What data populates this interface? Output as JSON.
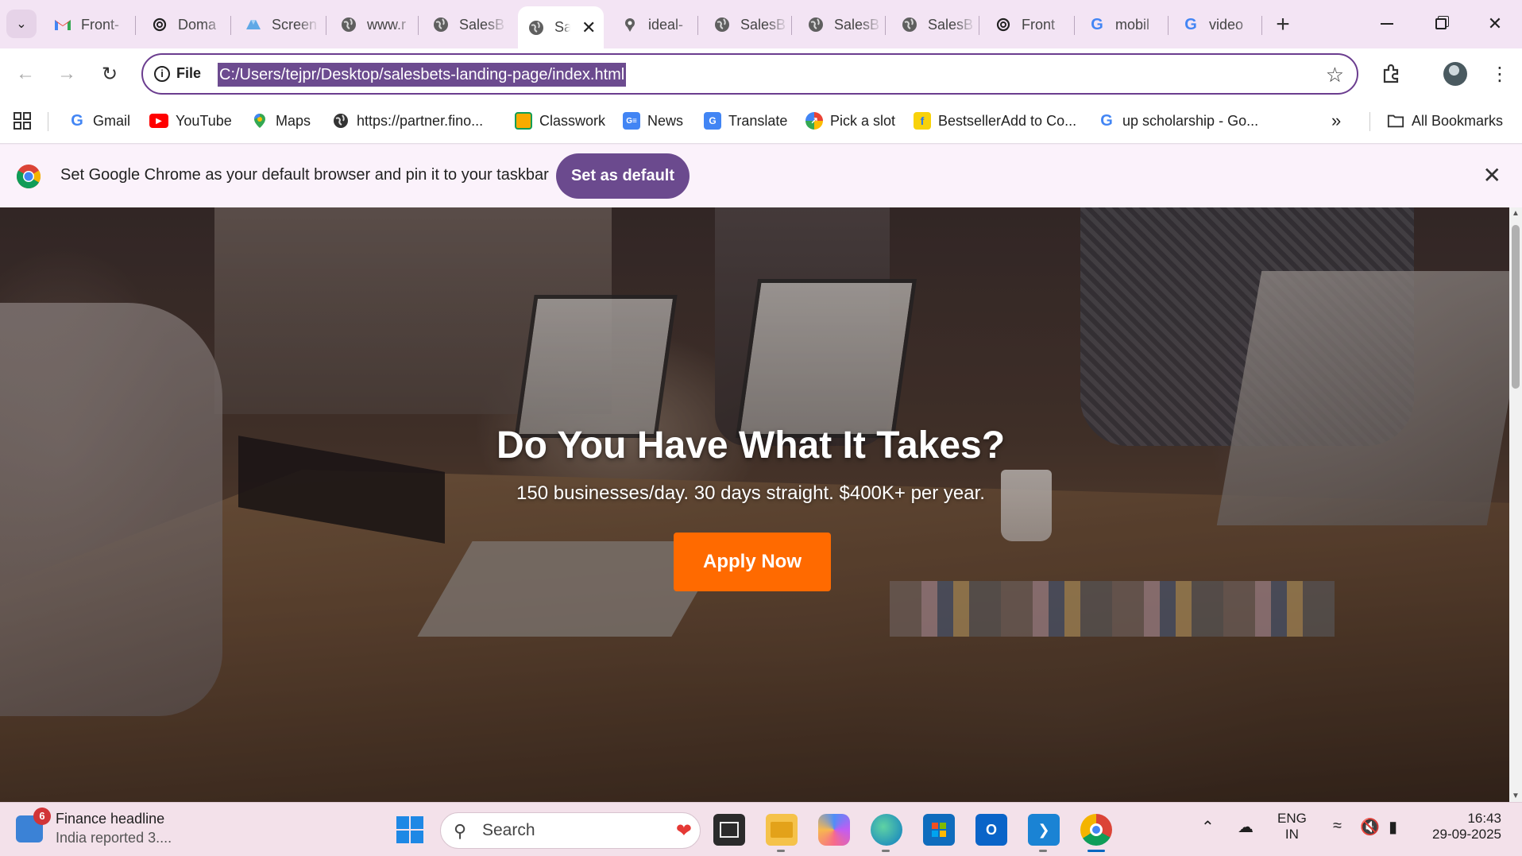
{
  "browser": {
    "tabs": [
      {
        "label": "Front-",
        "icon": "gmail-icon"
      },
      {
        "label": "Doma",
        "icon": "chatgpt-icon"
      },
      {
        "label": "Screen",
        "icon": "cloud-icon"
      },
      {
        "label": "www.r",
        "icon": "globe-icon"
      },
      {
        "label": "SalesB",
        "icon": "globe-icon"
      },
      {
        "label": "Sa",
        "icon": "globe-icon",
        "active": true
      },
      {
        "label": "ideal-",
        "icon": "pin-icon"
      },
      {
        "label": "SalesB",
        "icon": "globe-icon"
      },
      {
        "label": "SalesB",
        "icon": "globe-icon"
      },
      {
        "label": "SalesB",
        "icon": "globe-icon"
      },
      {
        "label": "Front",
        "icon": "chatgpt-icon"
      },
      {
        "label": "mobil",
        "icon": "google-icon"
      },
      {
        "label": "video",
        "icon": "google-icon"
      }
    ],
    "new_tab_label": "+",
    "address": {
      "scheme_label": "File",
      "url": "C:/Users/tejpr/Desktop/salesbets-landing-page/index.html"
    },
    "bookmarks": [
      {
        "label": "Gmail",
        "icon": "google-icon"
      },
      {
        "label": "YouTube",
        "icon": "youtube-icon"
      },
      {
        "label": "Maps",
        "icon": "maps-icon"
      },
      {
        "label": "https://partner.fino...",
        "icon": "globe-icon"
      },
      {
        "label": "Classwork",
        "icon": "classroom-icon"
      },
      {
        "label": "News",
        "icon": "news-icon"
      },
      {
        "label": "Translate",
        "icon": "translate-icon"
      },
      {
        "label": "Pick a slot",
        "icon": "pick-icon"
      },
      {
        "label": "BestsellerAdd to Co...",
        "icon": "flipkart-icon"
      },
      {
        "label": "up scholarship - Go...",
        "icon": "google-icon"
      }
    ],
    "all_bookmarks_label": "All Bookmarks",
    "infobar": {
      "text": "Set Google Chrome as your default browser and pin it to your taskbar",
      "button_label": "Set as default"
    }
  },
  "hero": {
    "title": "Do You Have What It Takes?",
    "subtitle": "150 businesses/day. 30 days straight. $400K+ per year.",
    "cta_label": "Apply Now"
  },
  "taskbar": {
    "news": {
      "badge": "6",
      "title": "Finance headline",
      "subtitle": "India reported 3...."
    },
    "search_placeholder": "Search",
    "language": {
      "line1": "ENG",
      "line2": "IN"
    },
    "clock": {
      "time": "16:43",
      "date": "29-09-2025"
    }
  },
  "colors": {
    "accent": "#6b4a8e",
    "cta": "#ff6a00",
    "tabstrip": "#f3e4f4"
  }
}
